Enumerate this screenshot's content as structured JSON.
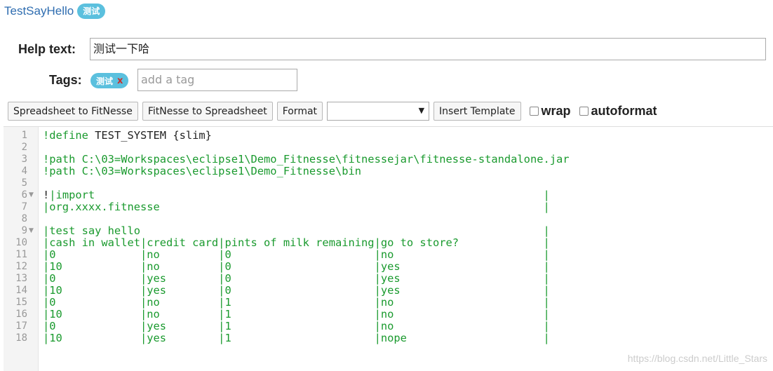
{
  "header": {
    "page_name": "TestSayHello",
    "badge": "测试"
  },
  "form": {
    "help_label": "Help text:",
    "help_value": "测试一下哈",
    "tags_label": "Tags:",
    "tag_chip": "测试",
    "tag_remove": "x",
    "tag_placeholder": "add a tag"
  },
  "toolbar": {
    "spreadsheet_to_fitnesse": "Spreadsheet to FitNesse",
    "fitnesse_to_spreadsheet": "FitNesse to Spreadsheet",
    "format": "Format",
    "template_select_value": "",
    "insert_template": "Insert Template",
    "wrap": "wrap",
    "autoformat": "autoformat"
  },
  "editor": {
    "line_numbers": [
      "1",
      "2",
      "3",
      "4",
      "5",
      "6",
      "7",
      "8",
      "9",
      "10",
      "11",
      "12",
      "13",
      "14",
      "15",
      "16",
      "17",
      "18"
    ],
    "lines": [
      [
        {
          "t": "!define",
          "c": "g"
        },
        {
          "t": " TEST_SYSTEM {slim}",
          "c": "k"
        }
      ],
      [],
      [
        {
          "t": "!path C:\\03=Workspaces\\eclipse1\\Demo_Fitnesse\\fitnessejar\\fitnesse-standalone.jar",
          "c": "g"
        }
      ],
      [
        {
          "t": "!path C:\\03=Workspaces\\eclipse1\\Demo_Fitnesse\\bin",
          "c": "g"
        }
      ],
      [],
      [
        {
          "t": "!",
          "c": "k"
        },
        {
          "t": "|import                                                                     |",
          "c": "g"
        }
      ],
      [
        {
          "t": "|org.xxxx.fitnesse                                                           |",
          "c": "g"
        }
      ],
      [],
      [
        {
          "t": "|test say hello                                                              |",
          "c": "g"
        }
      ],
      [
        {
          "t": "|cash in wallet|credit card|pints of milk remaining|go to store?             |",
          "c": "g"
        }
      ],
      [
        {
          "t": "|0             |no         |0                      |no                       |",
          "c": "g"
        }
      ],
      [
        {
          "t": "|10            |no         |0                      |yes                      |",
          "c": "g"
        }
      ],
      [
        {
          "t": "|0             |yes        |0                      |yes                      |",
          "c": "g"
        }
      ],
      [
        {
          "t": "|10            |yes        |0                      |yes                      |",
          "c": "g"
        }
      ],
      [
        {
          "t": "|0             |no         |1                      |no                       |",
          "c": "g"
        }
      ],
      [
        {
          "t": "|10            |no         |1                      |no                       |",
          "c": "g"
        }
      ],
      [
        {
          "t": "|0             |yes        |1                      |no                       |",
          "c": "g"
        }
      ],
      [
        {
          "t": "|10            |yes        |1                      |nope                     |",
          "c": "g"
        }
      ]
    ]
  },
  "watermark": "https://blog.csdn.net/Little_Stars"
}
